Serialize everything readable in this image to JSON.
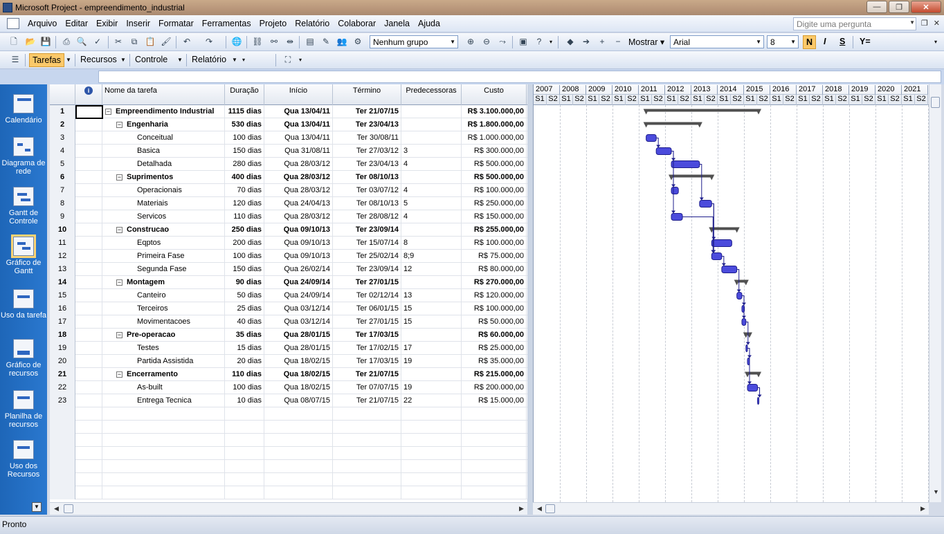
{
  "window": {
    "title": "Microsoft Project - empreendimento_industrial",
    "btn_min": "—",
    "btn_max": "❐",
    "btn_close": "✕"
  },
  "menu": {
    "items": [
      "Arquivo",
      "Editar",
      "Exibir",
      "Inserir",
      "Formatar",
      "Ferramentas",
      "Projeto",
      "Relatório",
      "Colaborar",
      "Janela",
      "Ajuda"
    ],
    "ask_placeholder": "Digite uma pergunta"
  },
  "toolbar": {
    "group_combo": "Nenhum grupo",
    "show_label": "Mostrar",
    "font_combo": "Arial",
    "size_combo": "8",
    "bold": "N",
    "italic": "I",
    "underline": "S",
    "filter_icon": "Y="
  },
  "toolbar2": {
    "tasks": "Tarefas",
    "resources": "Recursos",
    "control": "Controle",
    "report": "Relatório"
  },
  "viewbar": [
    {
      "label": "Calendário",
      "icon": "calendar-icon"
    },
    {
      "label": "Diagrama de rede",
      "icon": "network-diagram-icon"
    },
    {
      "label": "Gantt de Controle",
      "icon": "tracking-gantt-icon"
    },
    {
      "label": "Gráfico de Gantt",
      "icon": "gantt-chart-icon"
    },
    {
      "label": "Uso da tarefa",
      "icon": "task-usage-icon"
    },
    {
      "label": "Gráfico de recursos",
      "icon": "resource-graph-icon"
    },
    {
      "label": "Planilha de recursos",
      "icon": "resource-sheet-icon"
    },
    {
      "label": "Uso dos Recursos",
      "icon": "resource-usage-icon"
    }
  ],
  "columns": {
    "indicators": "i",
    "name": "Nome da tarefa",
    "duration": "Duração",
    "start": "Início",
    "finish": "Término",
    "predecessors": "Predecessoras",
    "cost": "Custo"
  },
  "tasks": [
    {
      "id": "1",
      "name": "Empreendimento Industrial",
      "duration": "1115 dias",
      "start": "Qua 13/04/11",
      "finish": "Ter 21/07/15",
      "pred": "",
      "cost": "R$ 3.100.000,00",
      "level": 0,
      "summary": true
    },
    {
      "id": "2",
      "name": "Engenharia",
      "duration": "530 dias",
      "start": "Qua 13/04/11",
      "finish": "Ter 23/04/13",
      "pred": "",
      "cost": "R$ 1.800.000,00",
      "level": 1,
      "summary": true
    },
    {
      "id": "3",
      "name": "Conceitual",
      "duration": "100 dias",
      "start": "Qua 13/04/11",
      "finish": "Ter 30/08/11",
      "pred": "",
      "cost": "R$ 1.000.000,00",
      "level": 2,
      "summary": false
    },
    {
      "id": "4",
      "name": "Basica",
      "duration": "150 dias",
      "start": "Qua 31/08/11",
      "finish": "Ter 27/03/12",
      "pred": "3",
      "cost": "R$ 300.000,00",
      "level": 2,
      "summary": false
    },
    {
      "id": "5",
      "name": "Detalhada",
      "duration": "280 dias",
      "start": "Qua 28/03/12",
      "finish": "Ter 23/04/13",
      "pred": "4",
      "cost": "R$ 500.000,00",
      "level": 2,
      "summary": false
    },
    {
      "id": "6",
      "name": "Suprimentos",
      "duration": "400 dias",
      "start": "Qua 28/03/12",
      "finish": "Ter 08/10/13",
      "pred": "",
      "cost": "R$ 500.000,00",
      "level": 1,
      "summary": true
    },
    {
      "id": "7",
      "name": "Operacionais",
      "duration": "70 dias",
      "start": "Qua 28/03/12",
      "finish": "Ter 03/07/12",
      "pred": "4",
      "cost": "R$ 100.000,00",
      "level": 2,
      "summary": false
    },
    {
      "id": "8",
      "name": "Materiais",
      "duration": "120 dias",
      "start": "Qua 24/04/13",
      "finish": "Ter 08/10/13",
      "pred": "5",
      "cost": "R$ 250.000,00",
      "level": 2,
      "summary": false
    },
    {
      "id": "9",
      "name": "Servicos",
      "duration": "110 dias",
      "start": "Qua 28/03/12",
      "finish": "Ter 28/08/12",
      "pred": "4",
      "cost": "R$ 150.000,00",
      "level": 2,
      "summary": false
    },
    {
      "id": "10",
      "name": "Construcao",
      "duration": "250 dias",
      "start": "Qua 09/10/13",
      "finish": "Ter 23/09/14",
      "pred": "",
      "cost": "R$ 255.000,00",
      "level": 1,
      "summary": true
    },
    {
      "id": "11",
      "name": "Eqptos",
      "duration": "200 dias",
      "start": "Qua 09/10/13",
      "finish": "Ter 15/07/14",
      "pred": "8",
      "cost": "R$ 100.000,00",
      "level": 2,
      "summary": false
    },
    {
      "id": "12",
      "name": "Primeira Fase",
      "duration": "100 dias",
      "start": "Qua 09/10/13",
      "finish": "Ter 25/02/14",
      "pred": "8;9",
      "cost": "R$ 75.000,00",
      "level": 2,
      "summary": false
    },
    {
      "id": "13",
      "name": "Segunda Fase",
      "duration": "150 dias",
      "start": "Qua 26/02/14",
      "finish": "Ter 23/09/14",
      "pred": "12",
      "cost": "R$ 80.000,00",
      "level": 2,
      "summary": false
    },
    {
      "id": "14",
      "name": "Montagem",
      "duration": "90 dias",
      "start": "Qua 24/09/14",
      "finish": "Ter 27/01/15",
      "pred": "",
      "cost": "R$ 270.000,00",
      "level": 1,
      "summary": true
    },
    {
      "id": "15",
      "name": "Canteiro",
      "duration": "50 dias",
      "start": "Qua 24/09/14",
      "finish": "Ter 02/12/14",
      "pred": "13",
      "cost": "R$ 120.000,00",
      "level": 2,
      "summary": false
    },
    {
      "id": "16",
      "name": "Terceiros",
      "duration": "25 dias",
      "start": "Qua 03/12/14",
      "finish": "Ter 06/01/15",
      "pred": "15",
      "cost": "R$ 100.000,00",
      "level": 2,
      "summary": false
    },
    {
      "id": "17",
      "name": "Movimentacoes",
      "duration": "40 dias",
      "start": "Qua 03/12/14",
      "finish": "Ter 27/01/15",
      "pred": "15",
      "cost": "R$ 50.000,00",
      "level": 2,
      "summary": false
    },
    {
      "id": "18",
      "name": "Pre-operacao",
      "duration": "35 dias",
      "start": "Qua 28/01/15",
      "finish": "Ter 17/03/15",
      "pred": "",
      "cost": "R$ 60.000,00",
      "level": 1,
      "summary": true
    },
    {
      "id": "19",
      "name": "Testes",
      "duration": "15 dias",
      "start": "Qua 28/01/15",
      "finish": "Ter 17/02/15",
      "pred": "17",
      "cost": "R$ 25.000,00",
      "level": 2,
      "summary": false
    },
    {
      "id": "20",
      "name": "Partida Assistida",
      "duration": "20 dias",
      "start": "Qua 18/02/15",
      "finish": "Ter 17/03/15",
      "pred": "19",
      "cost": "R$ 35.000,00",
      "level": 2,
      "summary": false
    },
    {
      "id": "21",
      "name": "Encerramento",
      "duration": "110 dias",
      "start": "Qua 18/02/15",
      "finish": "Ter 21/07/15",
      "pred": "",
      "cost": "R$ 215.000,00",
      "level": 1,
      "summary": true
    },
    {
      "id": "22",
      "name": "As-built",
      "duration": "100 dias",
      "start": "Qua 18/02/15",
      "finish": "Ter 07/07/15",
      "pred": "19",
      "cost": "R$ 200.000,00",
      "level": 2,
      "summary": false
    },
    {
      "id": "23",
      "name": "Entrega Tecnica",
      "duration": "10 dias",
      "start": "Qua 08/07/15",
      "finish": "Ter 21/07/15",
      "pred": "22",
      "cost": "R$ 15.000,00",
      "level": 2,
      "summary": false
    }
  ],
  "gantt": {
    "years": [
      "2007",
      "2008",
      "2009",
      "2010",
      "2011",
      "2012",
      "2013",
      "2014",
      "2015",
      "2016",
      "2017",
      "2018",
      "2019",
      "2020",
      "2021"
    ],
    "halves": [
      "S1",
      "S2"
    ],
    "first_year": 2007,
    "colors": {
      "task": "#4b4bdc",
      "task_edge": "#1e1e8c",
      "summary": "#505050",
      "link": "#1e1e8c"
    }
  },
  "status": {
    "text": "Pronto"
  }
}
